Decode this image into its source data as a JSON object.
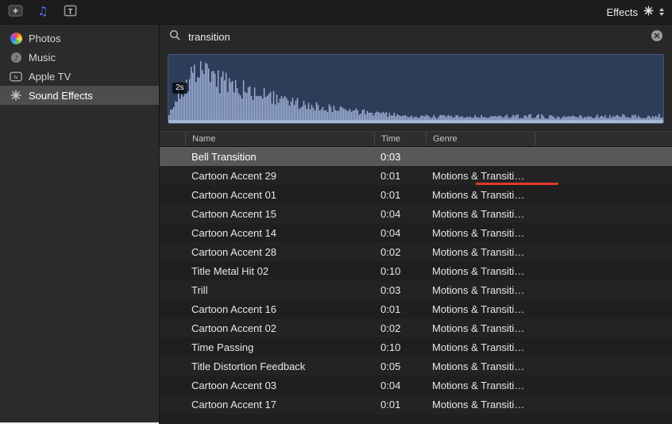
{
  "toolbar": {
    "effects_label": "Effects"
  },
  "sidebar": {
    "items": [
      {
        "id": "photos",
        "label": "Photos",
        "selected": false
      },
      {
        "id": "music",
        "label": "Music",
        "selected": false
      },
      {
        "id": "appletv",
        "label": "Apple TV",
        "selected": false
      },
      {
        "id": "soundfx",
        "label": "Sound Effects",
        "selected": true
      }
    ]
  },
  "search": {
    "value": "transition"
  },
  "preview": {
    "duration_label": "2s",
    "bars": 312,
    "seed": 7
  },
  "table": {
    "columns": [
      "Name",
      "Time",
      "Genre"
    ],
    "rows": [
      {
        "name": "Bell Transition",
        "time": "0:03",
        "genre": "",
        "selected": true
      },
      {
        "name": "Cartoon Accent 29",
        "time": "0:01",
        "genre": "Motions & Transiti…",
        "annotated": true
      },
      {
        "name": "Cartoon Accent 01",
        "time": "0:01",
        "genre": "Motions & Transiti…"
      },
      {
        "name": "Cartoon Accent 15",
        "time": "0:04",
        "genre": "Motions & Transiti…"
      },
      {
        "name": "Cartoon Accent 14",
        "time": "0:04",
        "genre": "Motions & Transiti…"
      },
      {
        "name": "Cartoon Accent 28",
        "time": "0:02",
        "genre": "Motions & Transiti…"
      },
      {
        "name": "Title Metal Hit 02",
        "time": "0:10",
        "genre": "Motions & Transiti…"
      },
      {
        "name": "Trill",
        "time": "0:03",
        "genre": "Motions & Transiti…"
      },
      {
        "name": "Cartoon Accent 16",
        "time": "0:01",
        "genre": "Motions & Transiti…"
      },
      {
        "name": "Cartoon Accent 02",
        "time": "0:02",
        "genre": "Motions & Transiti…"
      },
      {
        "name": "Time Passing",
        "time": "0:10",
        "genre": "Motions & Transiti…"
      },
      {
        "name": "Title Distortion Feedback",
        "time": "0:05",
        "genre": "Motions & Transiti…"
      },
      {
        "name": "Cartoon Accent 03",
        "time": "0:04",
        "genre": "Motions & Transiti…"
      },
      {
        "name": "Cartoon Accent 17",
        "time": "0:01",
        "genre": "Motions & Transiti…"
      }
    ]
  },
  "colors": {
    "annotation_red": "#e0392e",
    "waveform_bg": "#2d3c58",
    "waveform_bar": "#9db0d6",
    "waveform_base": "#b7c4e0",
    "selection_gray": "#585858"
  }
}
